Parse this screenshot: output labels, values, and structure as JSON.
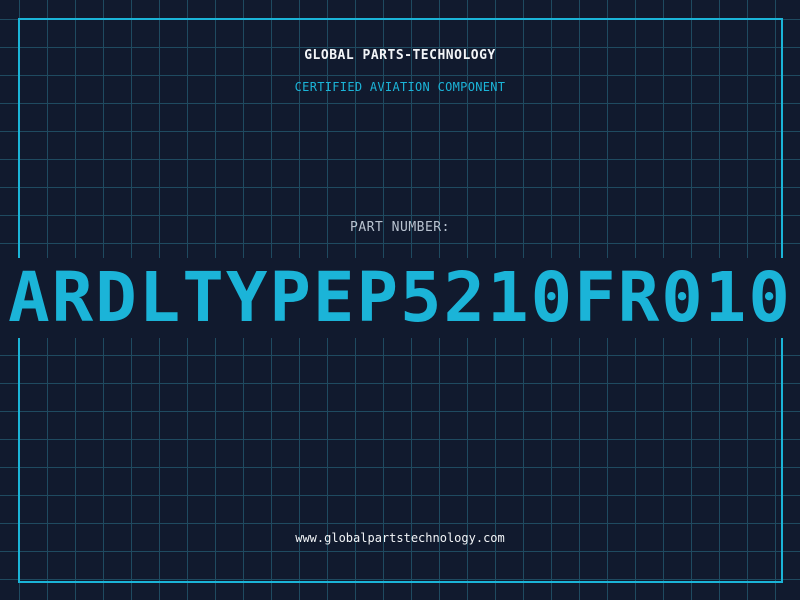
{
  "header": {
    "company": "GLOBAL PARTS-TECHNOLOGY",
    "subtitle": "CERTIFIED AVIATION COMPONENT"
  },
  "part": {
    "label": "PART NUMBER:",
    "number": "ARDLTYPEP5210FR010"
  },
  "footer": {
    "url": "www.globalpartstechnology.com"
  },
  "colors": {
    "background": "#111a2e",
    "grid": "#1f4a60",
    "accent": "#1bb4d8",
    "text": "#f2f4f7"
  }
}
